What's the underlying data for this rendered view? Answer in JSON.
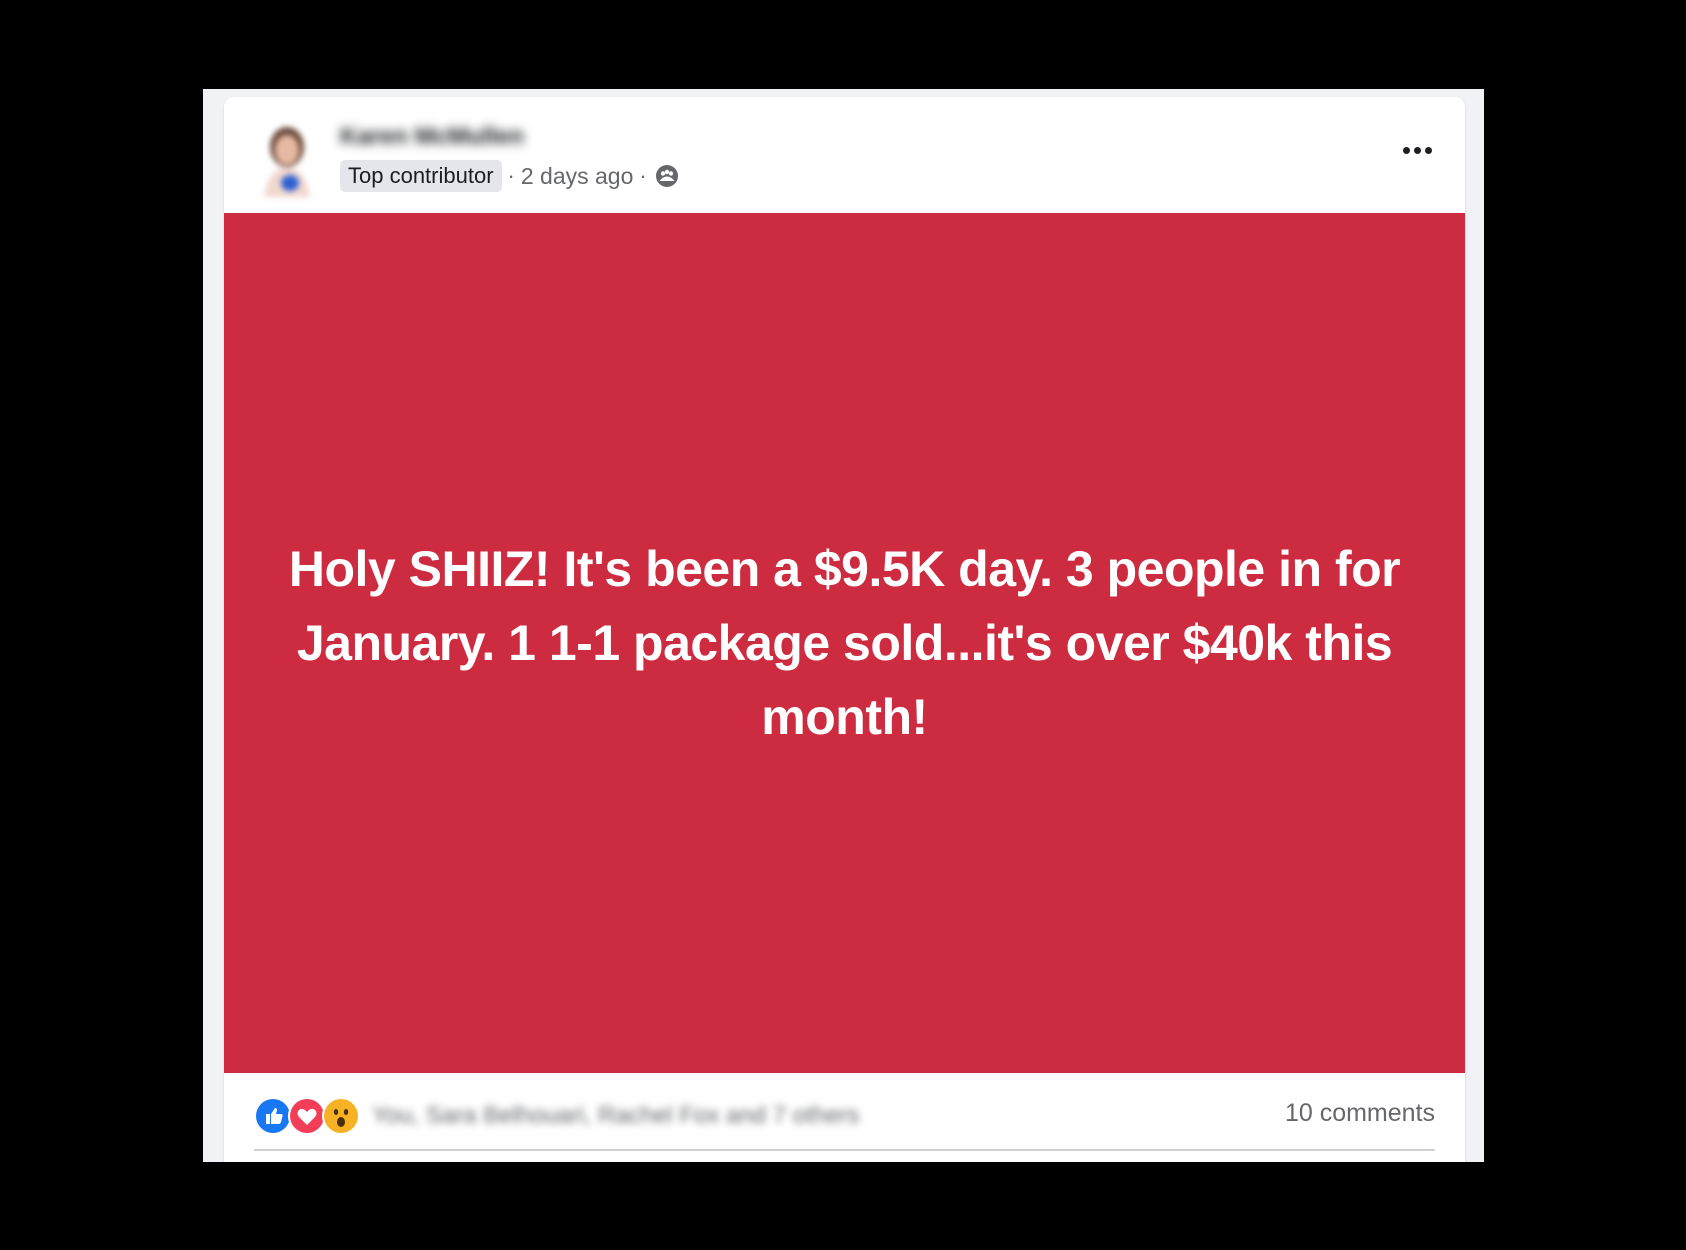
{
  "post": {
    "author_name": "Karen McMullen",
    "badge": "Top contributor",
    "separator": "·",
    "time": "2 days ago",
    "privacy_icon": "group-privacy-icon",
    "more_icon": "more-options-icon",
    "text": "Holy SHIIZ! It's been a $9.5K day. 3 people in for January. 1 1-1 package sold...it's over $40k this month!",
    "background_color": "#cd2b40"
  },
  "footer": {
    "reactions": [
      "like-icon",
      "love-icon",
      "wow-icon"
    ],
    "reactors_text": "You, Sara Belhouari, Rachel Fox and 7 others",
    "comments_text": "10 comments"
  },
  "colors": {
    "page_background": "#000000",
    "feed_background": "#f0f2f5",
    "like": "#1877f2",
    "love": "#f33e58",
    "wow": "#f7b125"
  }
}
